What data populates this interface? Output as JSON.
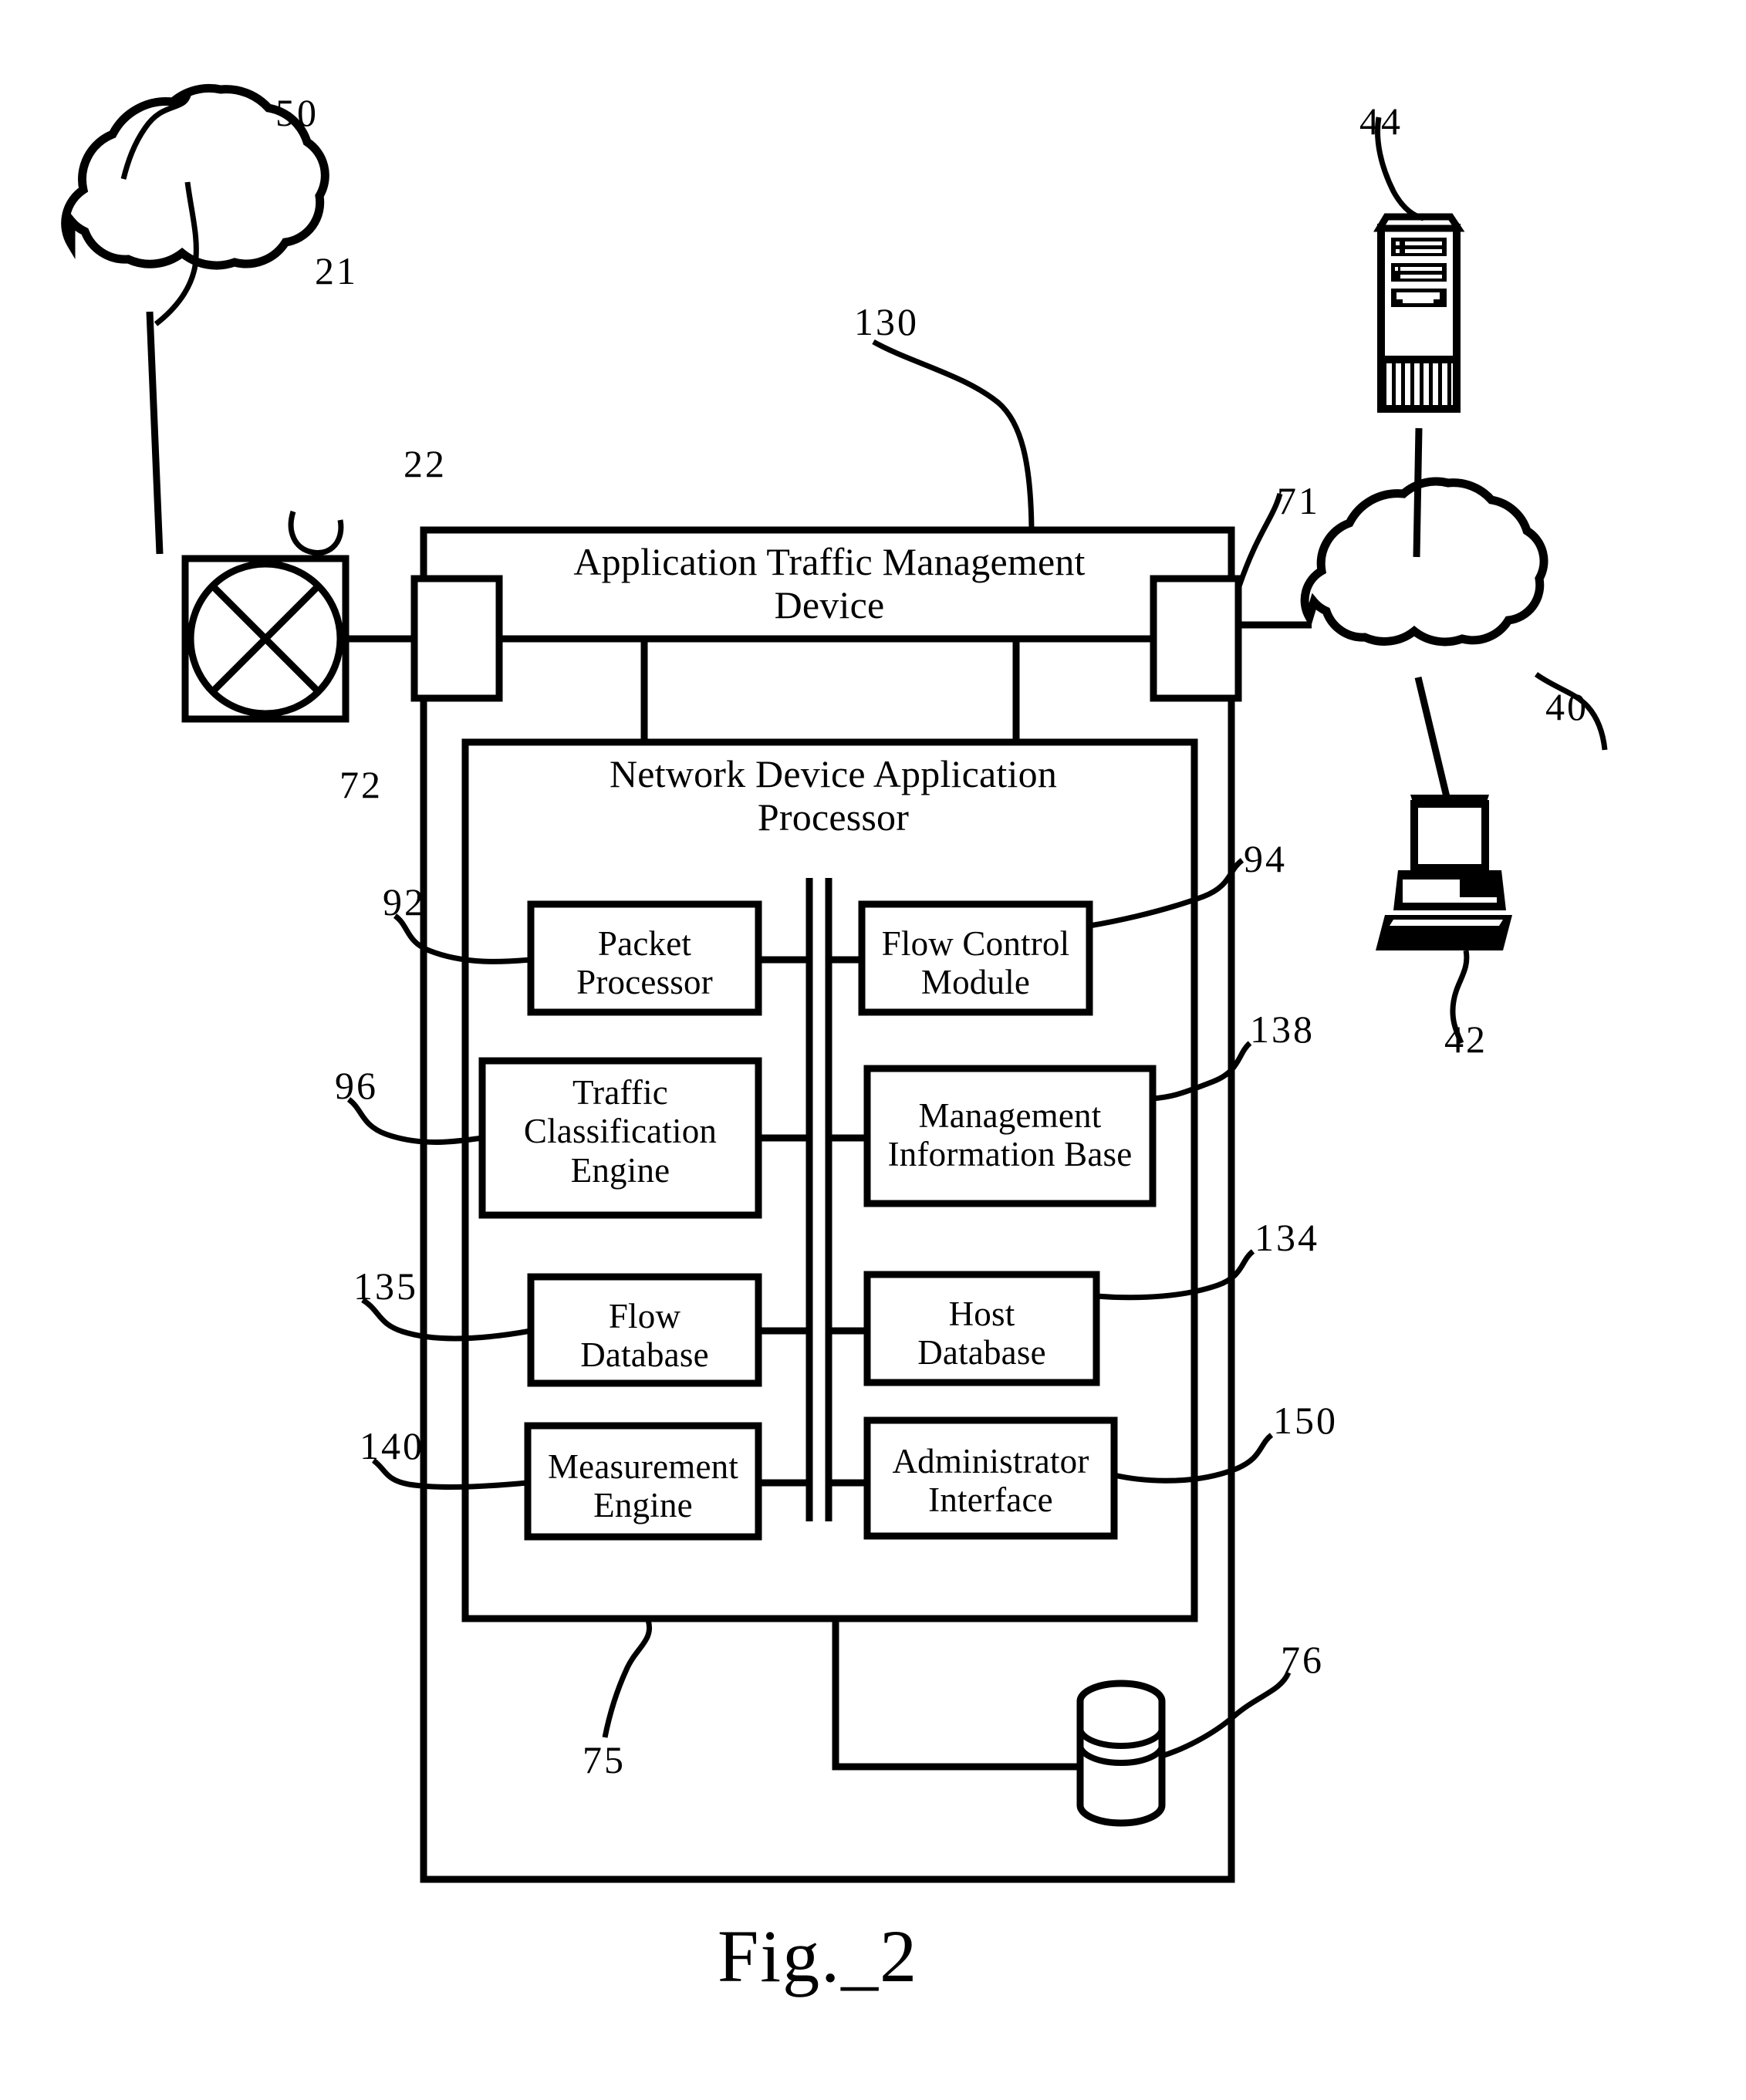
{
  "figure": {
    "caption": "Fig._2",
    "domain": "patent-diagram"
  },
  "outer_device": {
    "title": "Application Traffic Management\nDevice",
    "ref": "130"
  },
  "processor": {
    "title": "Network Device Application\nProcessor",
    "ref": "75"
  },
  "modules": [
    {
      "label": "Packet\nProcessor",
      "ref": "92",
      "ref_side": "left"
    },
    {
      "label": "Flow Control\nModule",
      "ref": "94",
      "ref_side": "right"
    },
    {
      "label": "Traffic\nClassification\nEngine",
      "ref": "96",
      "ref_side": "left"
    },
    {
      "label": "Management\nInformation Base",
      "ref": "138",
      "ref_side": "right"
    },
    {
      "label": "Flow\nDatabase",
      "ref": "135",
      "ref_side": "left"
    },
    {
      "label": "Host\nDatabase",
      "ref": "134",
      "ref_side": "right"
    },
    {
      "label": "Measurement\nEngine",
      "ref": "140",
      "ref_side": "left"
    },
    {
      "label": "Administrator\nInterface",
      "ref": "150",
      "ref_side": "right"
    }
  ],
  "nodes": [
    {
      "name": "cloud-50",
      "icon": "cloud-icon",
      "ref": "50"
    },
    {
      "name": "link-21",
      "icon": "link-line",
      "ref": "21"
    },
    {
      "name": "router-22",
      "icon": "router-icon",
      "ref": "22"
    },
    {
      "name": "interface-72",
      "icon": "network-interface",
      "ref": "72"
    },
    {
      "name": "interface-71",
      "icon": "network-interface",
      "ref": "71"
    },
    {
      "name": "cloud-40",
      "icon": "cloud-icon",
      "ref": "40"
    },
    {
      "name": "server-44",
      "icon": "server-tower-icon",
      "ref": "44"
    },
    {
      "name": "workstation-42",
      "icon": "computer-icon",
      "ref": "42"
    },
    {
      "name": "datastore-76",
      "icon": "database-cylinder-icon",
      "ref": "76"
    }
  ],
  "refs": {
    "r50": "50",
    "r21": "21",
    "r22": "22",
    "r72": "72",
    "r130": "130",
    "r71": "71",
    "r44": "44",
    "r40": "40",
    "r42": "42",
    "r92": "92",
    "r94": "94",
    "r96": "96",
    "r138": "138",
    "r135": "135",
    "r134": "134",
    "r140": "140",
    "r150": "150",
    "r75": "75",
    "r76": "76"
  },
  "colors": {
    "stroke": "#000000",
    "background": "#ffffff"
  }
}
